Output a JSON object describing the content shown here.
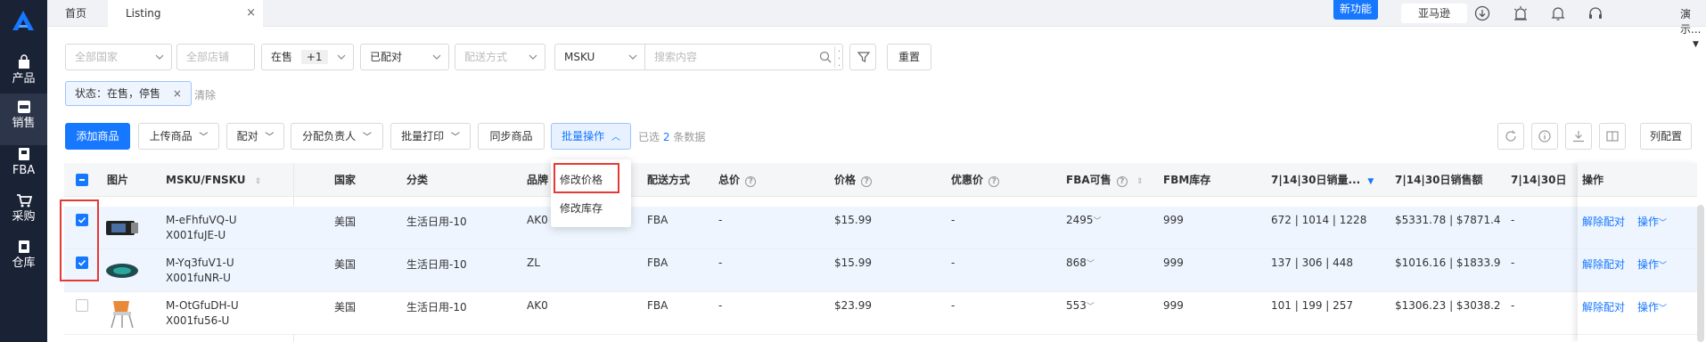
{
  "sidebar": {
    "items": [
      {
        "label": "产品",
        "icon": "bag-icon"
      },
      {
        "label": "销售",
        "icon": "sell-icon",
        "active": true
      },
      {
        "label": "FBA",
        "icon": "box-icon"
      },
      {
        "label": "采购",
        "icon": "cart-icon"
      },
      {
        "label": "仓库",
        "icon": "warehouse-icon"
      }
    ]
  },
  "topbar": {
    "tabs": [
      {
        "label": "首页"
      },
      {
        "label": "Listing",
        "close": "×"
      }
    ],
    "new_feature": "新功能",
    "marketplace": "亚马逊",
    "user": "演示..."
  },
  "filters": {
    "country_placeholder": "全部国家",
    "store_placeholder": "全部店铺",
    "status_value": "在售",
    "status_extra": "+1",
    "pairing_value": "已配对",
    "delivery_placeholder": "配送方式",
    "search_field": "MSKU",
    "search_placeholder": "搜索内容",
    "reset": "重置",
    "active_tag": "状态：在售，停售",
    "tag_close": "×",
    "clear": "清除"
  },
  "toolbar": {
    "add_product": "添加商品",
    "upload_product": "上传商品",
    "pair": "配对",
    "assign_owner": "分配负责人",
    "batch_print": "批量打印",
    "sync_product": "同步商品",
    "batch_ops": "批量操作",
    "selected_prefix": "已选",
    "selected_count": "2",
    "selected_suffix": "条数据",
    "column_config": "列配置"
  },
  "batch_menu": {
    "items": [
      "修改价格",
      "修改库存"
    ]
  },
  "table": {
    "headers": {
      "image": "图片",
      "msku": "MSKU/FNSKU",
      "country": "国家",
      "category": "分类",
      "brand": "品牌",
      "delivery": "配送方式",
      "total_price": "总价",
      "price": "价格",
      "sale_price": "优惠价",
      "fba_available": "FBA可售",
      "fbm_stock": "FBM库存",
      "sales_qty": "7|14|30日销量...",
      "sales_amount": "7|14|30日销售额",
      "more": "7|14|30日",
      "ops": "操作"
    },
    "rows": [
      {
        "checked": true,
        "msku": "M-eFhfuVQ-U",
        "fnsku": "X001fuJE-U",
        "country": "美国",
        "category": "生活日用-10",
        "brand": "AK0",
        "delivery": "FBA",
        "total": "-",
        "price": "$15.99",
        "sale": "-",
        "fba": "2495",
        "fbm": "999",
        "qty": "672 | 1014 | 1228",
        "amount": "$5331.78 | $7871.4",
        "more": "-",
        "unpair": "解除配对",
        "op": "操作"
      },
      {
        "checked": true,
        "msku": "M-Yq3fuV1-U",
        "fnsku": "X001fuNR-U",
        "country": "美国",
        "category": "生活日用-10",
        "brand": "ZL",
        "delivery": "FBA",
        "total": "-",
        "price": "$15.99",
        "sale": "-",
        "fba": "868",
        "fbm": "999",
        "qty": "137 | 306 | 448",
        "amount": "$1016.16 | $1833.9",
        "more": "-",
        "unpair": "解除配对",
        "op": "操作"
      },
      {
        "checked": false,
        "msku": "M-OtGfuDH-U",
        "fnsku": "X001fu56-U",
        "country": "美国",
        "category": "生活日用-10",
        "brand": "AK0",
        "delivery": "FBA",
        "total": "-",
        "price": "$23.99",
        "sale": "-",
        "fba": "553",
        "fbm": "999",
        "qty": "101 | 199 | 257",
        "amount": "$1306.23 | $3038.2",
        "more": "-",
        "unpair": "解除配对",
        "op": "操作"
      }
    ]
  },
  "colors": {
    "primary": "#1677ff",
    "sidebar": "#1a2236",
    "highlight": "#e53935"
  }
}
